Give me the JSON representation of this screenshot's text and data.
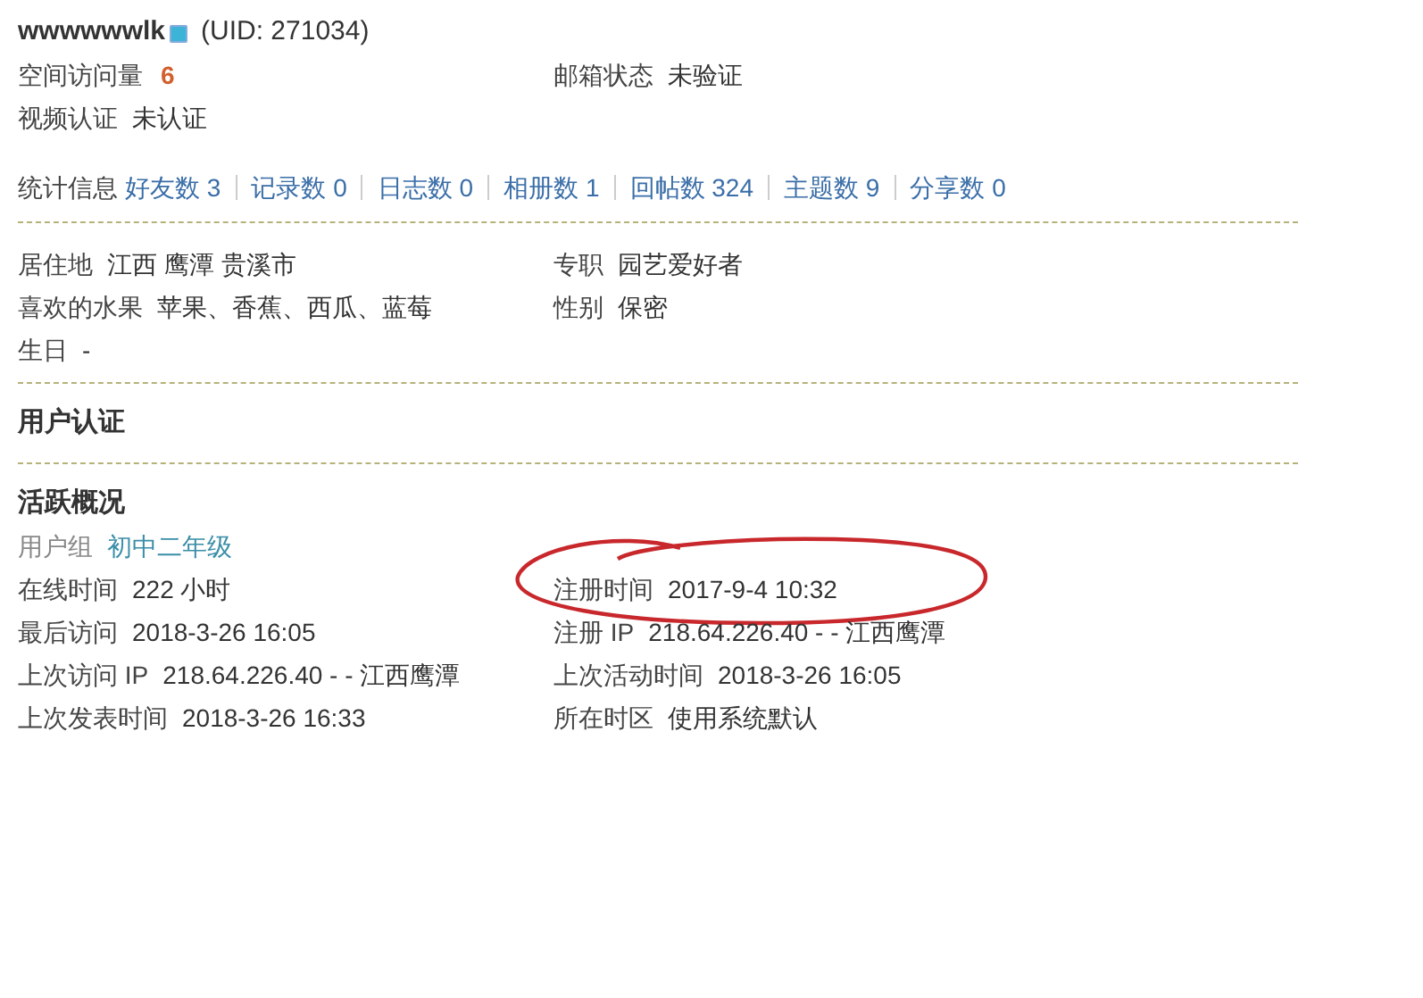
{
  "header": {
    "username": "wwwwwwlk",
    "uid": "(UID: 271034)"
  },
  "basic_rows": [
    {
      "left": {
        "label": "空间访问量",
        "value": "6",
        "kind": "count"
      },
      "right": {
        "label": "邮箱状态",
        "value": "未验证",
        "kind": "plain"
      }
    },
    {
      "left": {
        "label": "视频认证",
        "value": "未认证",
        "kind": "plain"
      }
    }
  ],
  "stats": {
    "label": "统计信息",
    "items": [
      {
        "text": "好友数 3"
      },
      {
        "text": "记录数 0"
      },
      {
        "text": "日志数 0"
      },
      {
        "text": "相册数 1"
      },
      {
        "text": "回帖数 324"
      },
      {
        "text": "主题数 9"
      },
      {
        "text": "分享数 0"
      }
    ]
  },
  "profile_rows": [
    {
      "left": {
        "label": "居住地",
        "value": "江西 鹰潭 贵溪市",
        "kind": "plain"
      },
      "right": {
        "label": "专职",
        "value": "园艺爱好者",
        "kind": "plain"
      }
    },
    {
      "left": {
        "label": "喜欢的水果",
        "value": "苹果、香蕉、西瓜、蓝莓",
        "kind": "plain"
      },
      "right": {
        "label": "性别",
        "value": "保密",
        "kind": "plain"
      }
    },
    {
      "left": {
        "label": "生日",
        "value": "-",
        "kind": "plain"
      }
    }
  ],
  "verification": {
    "title": "用户认证"
  },
  "activity": {
    "title": "活跃概况",
    "rows": [
      {
        "left": {
          "label": "用户组",
          "value": "初中二年级",
          "kind": "link"
        }
      },
      {
        "left": {
          "label": "在线时间",
          "value": "222 小时",
          "kind": "plain"
        },
        "right": {
          "label": "注册时间",
          "value": "2017-9-4 10:32",
          "kind": "plain",
          "circled": true
        }
      },
      {
        "left": {
          "label": "最后访问",
          "value": "2018-3-26 16:05",
          "kind": "plain"
        },
        "right": {
          "label": "注册 IP",
          "value": "218.64.226.40 - - 江西鹰潭",
          "kind": "plain"
        }
      },
      {
        "left": {
          "label": "上次访问 IP",
          "value": "218.64.226.40 - - 江西鹰潭",
          "kind": "plain"
        },
        "right": {
          "label": "上次活动时间",
          "value": "2018-3-26 16:05",
          "kind": "plain"
        }
      },
      {
        "left": {
          "label": "上次发表时间",
          "value": "2018-3-26 16:33",
          "kind": "plain"
        },
        "right": {
          "label": "所在时区",
          "value": "使用系统默认",
          "kind": "plain"
        }
      }
    ]
  }
}
